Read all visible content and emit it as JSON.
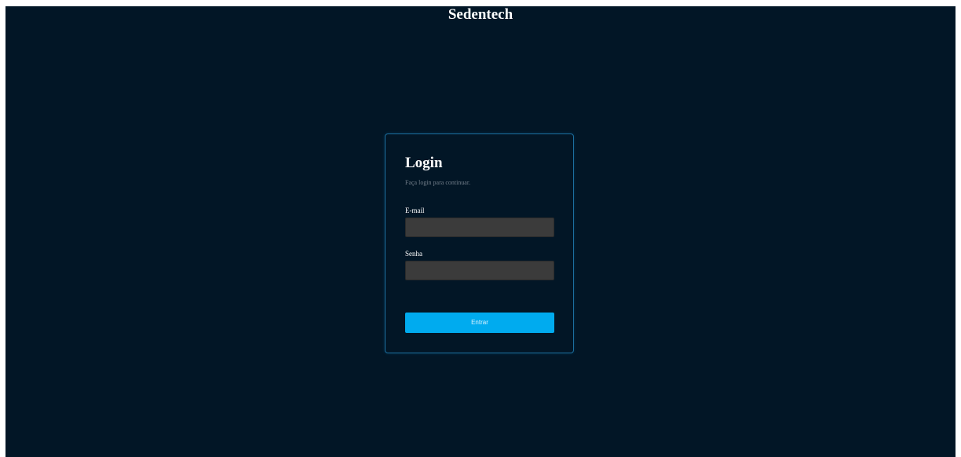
{
  "app": {
    "title": "Sedentech"
  },
  "login": {
    "title": "Login",
    "subtitle": "Faça login para continuar.",
    "email_label": "E-mail",
    "email_value": "",
    "email_placeholder": "",
    "password_label": "Senha",
    "password_value": "",
    "password_placeholder": "",
    "submit_label": "Entrar"
  },
  "colors": {
    "background": "#021626",
    "card_border": "#1c6f9f",
    "input_background": "#3b3b3b",
    "primary_button": "#00abef",
    "subtitle_text": "#707c88"
  }
}
